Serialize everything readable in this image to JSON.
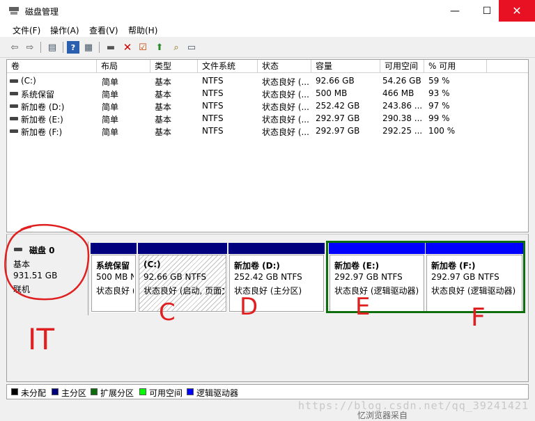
{
  "window": {
    "title": "磁盘管理",
    "min": "—",
    "max": "☐",
    "close": "✕"
  },
  "menu": [
    "文件(F)",
    "操作(A)",
    "查看(V)",
    "帮助(H)"
  ],
  "columns": [
    "卷",
    "布局",
    "类型",
    "文件系统",
    "状态",
    "容量",
    "可用空间",
    "% 可用"
  ],
  "rows": [
    {
      "vol": "(C:)",
      "layout": "简单",
      "type": "基本",
      "fs": "NTFS",
      "status": "状态良好 (...",
      "cap": "92.66 GB",
      "free": "54.26 GB",
      "pct": "59 %"
    },
    {
      "vol": "系统保留",
      "layout": "简单",
      "type": "基本",
      "fs": "NTFS",
      "status": "状态良好 (...",
      "cap": "500 MB",
      "free": "466 MB",
      "pct": "93 %"
    },
    {
      "vol": "新加卷 (D:)",
      "layout": "简单",
      "type": "基本",
      "fs": "NTFS",
      "status": "状态良好 (...",
      "cap": "252.42 GB",
      "free": "243.86 ...",
      "pct": "97 %"
    },
    {
      "vol": "新加卷 (E:)",
      "layout": "简单",
      "type": "基本",
      "fs": "NTFS",
      "status": "状态良好 (...",
      "cap": "292.97 GB",
      "free": "290.38 ...",
      "pct": "99 %"
    },
    {
      "vol": "新加卷 (F:)",
      "layout": "简单",
      "type": "基本",
      "fs": "NTFS",
      "status": "状态良好 (...",
      "cap": "292.97 GB",
      "free": "292.25 ...",
      "pct": "100 %"
    }
  ],
  "disk": {
    "name": "磁盘 0",
    "kind": "基本",
    "size": "931.51 GB",
    "state": "联机"
  },
  "partitions": [
    {
      "name": "系统保留",
      "size": "500 MB N",
      "status": "状态良好 (",
      "bar": "#00007f"
    },
    {
      "name": "(C:)",
      "size": "92.66 GB NTFS",
      "status": "状态良好 (启动, 页面文",
      "bar": "#00007f"
    },
    {
      "name": "新加卷 (D:)",
      "size": "252.42 GB NTFS",
      "status": "状态良好 (主分区)",
      "bar": "#00007f"
    },
    {
      "name": "新加卷 (E:)",
      "size": "292.97 GB NTFS",
      "status": "状态良好 (逻辑驱动器)",
      "bar": "#0000ff"
    },
    {
      "name": "新加卷 (F:)",
      "size": "292.97 GB NTFS",
      "status": "状态良好 (逻辑驱动器)",
      "bar": "#0000ff"
    }
  ],
  "legend": [
    {
      "label": "未分配",
      "color": "#000000"
    },
    {
      "label": "主分区",
      "color": "#00007f"
    },
    {
      "label": "扩展分区",
      "color": "#0e6e0e"
    },
    {
      "label": "可用空间",
      "color": "#00ff00"
    },
    {
      "label": "逻辑驱动器",
      "color": "#0000ff"
    }
  ],
  "annotations": {
    "disk": "IT",
    "c": "C",
    "d": "D",
    "e": "E",
    "f": "F"
  },
  "watermark": "https://blog.csdn.net/qq_39241421",
  "bottom_fragment": "忆浏览器采自"
}
